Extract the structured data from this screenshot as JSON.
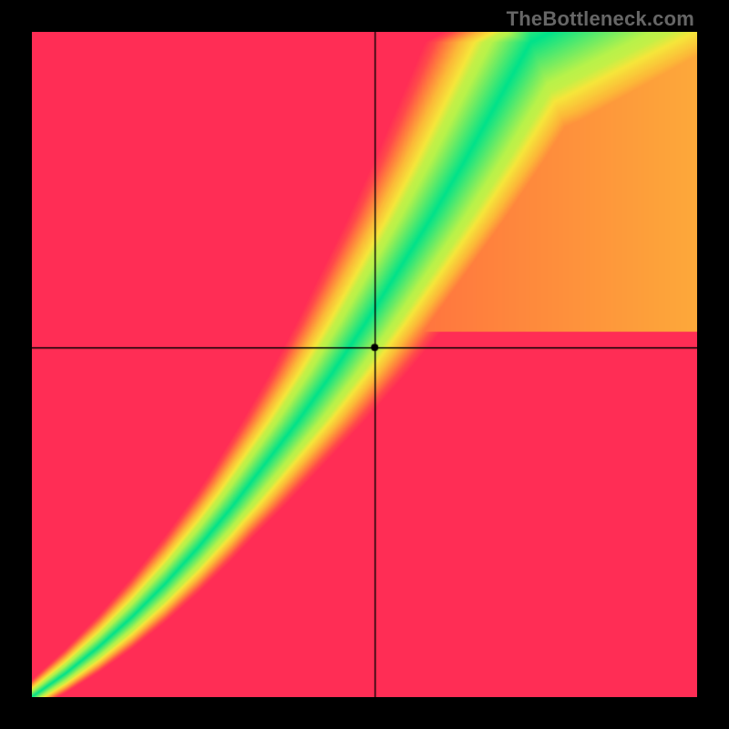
{
  "watermark": "TheBottleneck.com",
  "colors": {
    "background": "#000000",
    "crosshair": "#000000",
    "marker_fill": "#000000"
  },
  "chart_data": {
    "type": "heatmap",
    "title": "",
    "xlabel": "",
    "ylabel": "",
    "xlim": [
      0,
      1
    ],
    "ylim": [
      0,
      1
    ],
    "grid": false,
    "legend": false,
    "crosshair": {
      "x": 0.516,
      "y": 0.525
    },
    "marker": {
      "x": 0.516,
      "y": 0.525,
      "radius": 4
    },
    "optimal_curve": [
      {
        "x": 0.0,
        "y": 0.0
      },
      {
        "x": 0.05,
        "y": 0.035
      },
      {
        "x": 0.1,
        "y": 0.075
      },
      {
        "x": 0.15,
        "y": 0.12
      },
      {
        "x": 0.2,
        "y": 0.17
      },
      {
        "x": 0.25,
        "y": 0.225
      },
      {
        "x": 0.3,
        "y": 0.285
      },
      {
        "x": 0.35,
        "y": 0.35
      },
      {
        "x": 0.4,
        "y": 0.415
      },
      {
        "x": 0.45,
        "y": 0.485
      },
      {
        "x": 0.5,
        "y": 0.56
      },
      {
        "x": 0.55,
        "y": 0.64
      },
      {
        "x": 0.6,
        "y": 0.72
      },
      {
        "x": 0.65,
        "y": 0.805
      },
      {
        "x": 0.7,
        "y": 0.895
      },
      {
        "x": 0.75,
        "y": 0.985
      },
      {
        "x": 0.78,
        "y": 1.0
      }
    ],
    "band_width_start": 0.01,
    "band_width_end": 0.09,
    "color_scale": [
      {
        "t": 0.0,
        "color": "#00e28a"
      },
      {
        "t": 0.15,
        "color": "#b8f24a"
      },
      {
        "t": 0.3,
        "color": "#f6e63a"
      },
      {
        "t": 0.5,
        "color": "#fcb838"
      },
      {
        "t": 0.7,
        "color": "#ff7a3e"
      },
      {
        "t": 0.85,
        "color": "#ff4a4a"
      },
      {
        "t": 1.0,
        "color": "#ff2d55"
      }
    ]
  }
}
